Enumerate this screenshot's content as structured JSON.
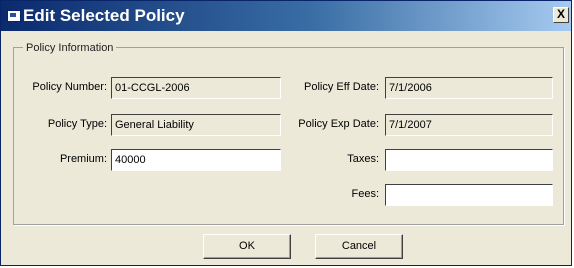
{
  "window": {
    "title": "Edit Selected Policy",
    "close_glyph": "X",
    "icon": "app-window-icon"
  },
  "group": {
    "label": "Policy Information"
  },
  "fields": {
    "policy_number": {
      "label": "Policy Number:",
      "value": "01-CCGL-2006"
    },
    "policy_eff_date": {
      "label": "Policy Eff Date:",
      "value": "7/1/2006"
    },
    "policy_type": {
      "label": "Policy Type:",
      "value": "General Liability"
    },
    "policy_exp_date": {
      "label": "Policy Exp Date:",
      "value": "7/1/2007"
    },
    "premium": {
      "label": "Premium:",
      "value": "40000"
    },
    "taxes": {
      "label": "Taxes:",
      "value": ""
    },
    "fees": {
      "label": "Fees:",
      "value": ""
    }
  },
  "buttons": {
    "ok": "OK",
    "cancel": "Cancel"
  },
  "colors": {
    "titlebar_start": "#0a2a6e",
    "titlebar_end": "#a6caf0",
    "dialog_bg": "#ece9d8"
  }
}
